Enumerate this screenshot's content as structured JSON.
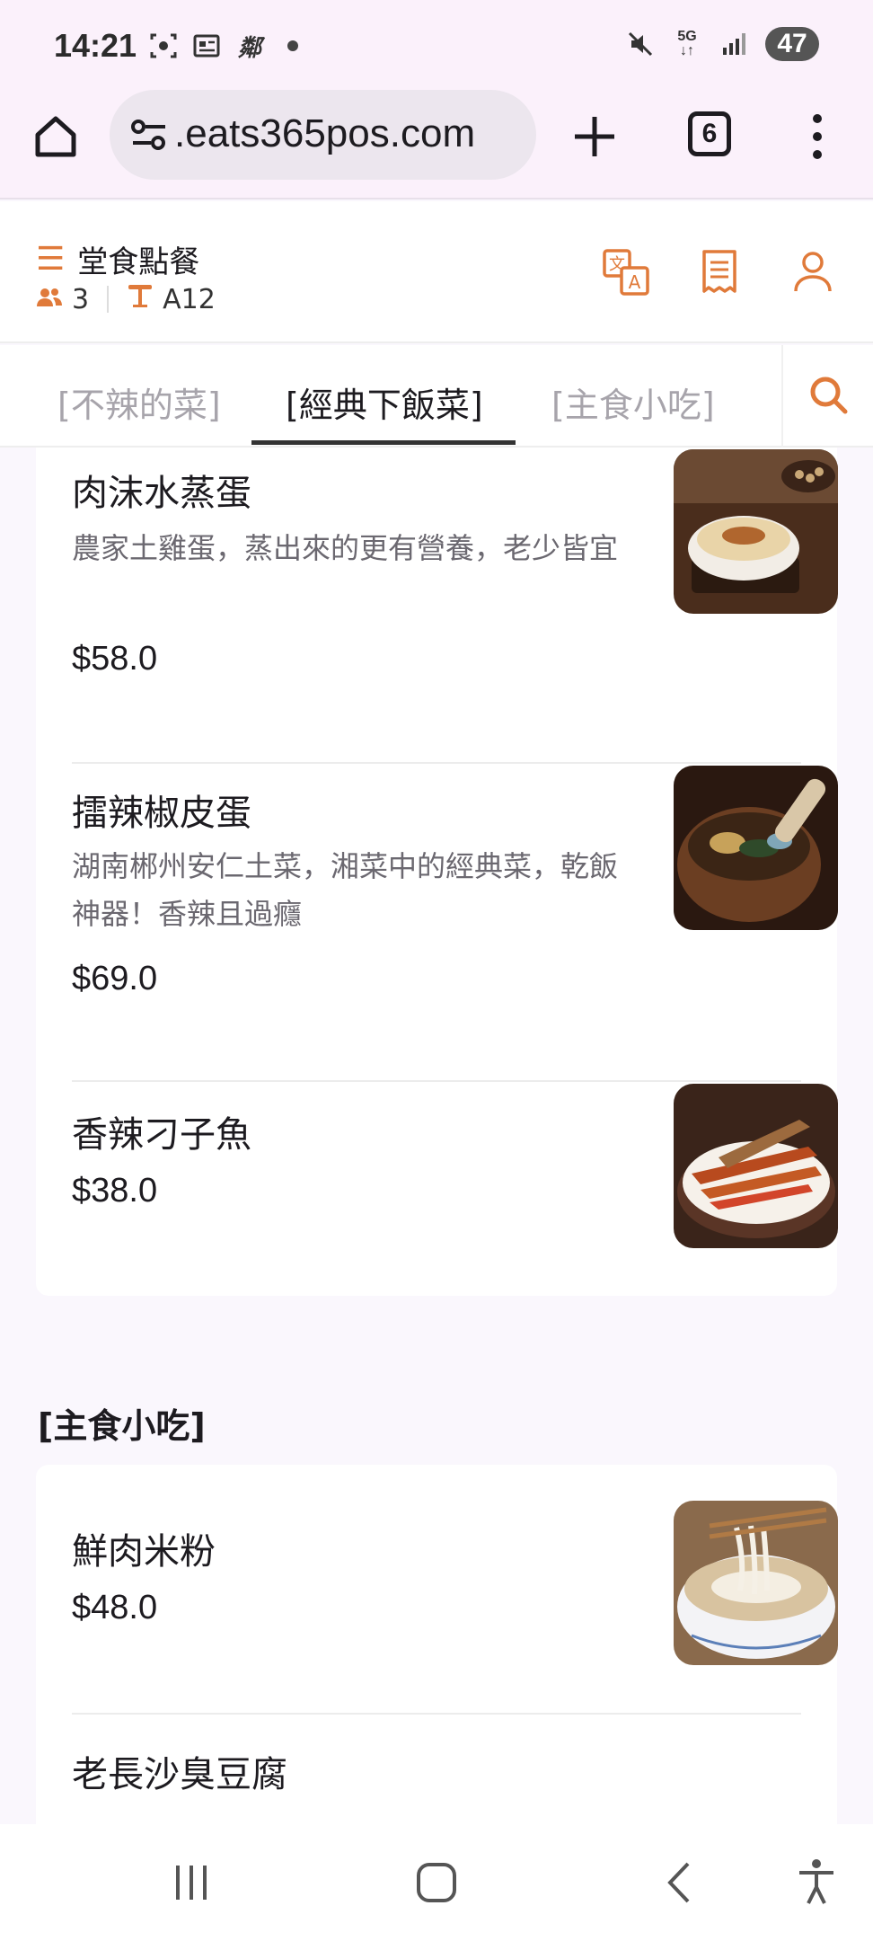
{
  "status_bar": {
    "time": "14:21",
    "network": "5G",
    "battery": "47",
    "icons": [
      "screenshot-icon",
      "news-icon",
      "app-icon",
      "dot-icon",
      "mute-icon",
      "network-icon",
      "signal-icon",
      "battery-icon"
    ]
  },
  "browser": {
    "url": ".eats365pos.com",
    "tab_count": "6"
  },
  "header": {
    "title": "堂食點餐",
    "guests": "3",
    "table": "A12",
    "accent_color": "#e07a3a"
  },
  "tabs": [
    {
      "label": "[不辣的菜]",
      "active": false
    },
    {
      "label": "[經典下飯菜]",
      "active": true
    },
    {
      "label": "[主食小吃]",
      "active": false
    }
  ],
  "menu": {
    "section1_items": [
      {
        "name": "肉沫水蒸蛋",
        "desc": "農家土雞蛋，蒸出來的更有營養，老少皆宜",
        "price": "$58.0"
      },
      {
        "name": "擂辣椒皮蛋",
        "desc": "湖南郴州安仁土菜，湘菜中的經典菜，乾飯神器！香辣且過癮",
        "price": "$69.0"
      },
      {
        "name": "香辣刁子魚",
        "desc": "",
        "price": "$38.0"
      }
    ],
    "section2_title": "[主食小吃]",
    "section2_items": [
      {
        "name": "鮮肉米粉",
        "price": "$48.0"
      },
      {
        "name": "老長沙臭豆腐"
      }
    ]
  }
}
